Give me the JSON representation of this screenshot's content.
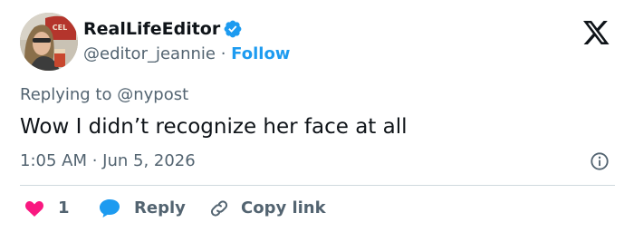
{
  "author": {
    "display_name": "RealLifeEditor",
    "handle": "@editor_jeannie",
    "separator": "·",
    "follow_label": "Follow",
    "verified_icon": "verified-badge-icon",
    "avatar_sign_text": "CEL"
  },
  "brand": {
    "logo_icon": "x-logo-icon"
  },
  "reply_context": {
    "prefix": "Replying to",
    "mention": "@nypost"
  },
  "tweet": {
    "text": "Wow I didn’t recognize her face at all",
    "time": "1:05 AM · Jun 5, 2026"
  },
  "actions": {
    "like_count": "1",
    "reply_label": "Reply",
    "copy_label": "Copy link"
  },
  "colors": {
    "accent": "#1d9bf0",
    "like": "#f91880",
    "text": "#0f1419",
    "muted": "#536471",
    "divider": "#cfd9de"
  }
}
